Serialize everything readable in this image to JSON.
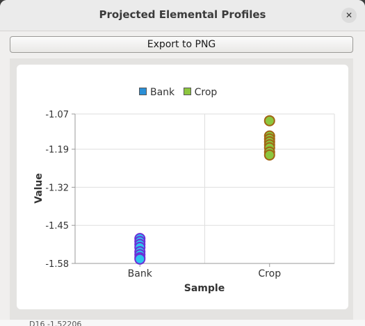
{
  "window": {
    "title": "Projected Elemental Profiles",
    "close_icon": "close-icon"
  },
  "toolbar": {
    "export_label": "Export to PNG"
  },
  "colors": {
    "bank_fill": "#2ec4ee",
    "bank_stroke": "#6b2fd6",
    "crop_fill": "#8cc63f",
    "crop_stroke": "#a26414",
    "bank_swatch": "#2b8fd6",
    "crop_swatch": "#8dc63f"
  },
  "chart_data": {
    "type": "scatter",
    "title": "",
    "xlabel": "Sample",
    "ylabel": "Value",
    "categories": [
      "Bank",
      "Crop"
    ],
    "ylim": [
      -1.58,
      -1.07
    ],
    "yticks": [
      "-1.07",
      "-1.19",
      "-1.32",
      "-1.45",
      "-1.58"
    ],
    "ytick_values": [
      -1.07,
      -1.19,
      -1.32,
      -1.45,
      -1.58
    ],
    "grid": true,
    "legend_position": "top-center",
    "series": [
      {
        "name": "Bank",
        "category": "Bank",
        "values": [
          -1.495,
          -1.505,
          -1.515,
          -1.525,
          -1.54,
          -1.55,
          -1.56,
          -1.565
        ]
      },
      {
        "name": "Crop",
        "category": "Crop",
        "values": [
          -1.093,
          -1.145,
          -1.155,
          -1.165,
          -1.175,
          -1.185,
          -1.2,
          -1.21
        ]
      }
    ]
  },
  "bottom": {
    "partial_text": "D16 -1.52206"
  }
}
